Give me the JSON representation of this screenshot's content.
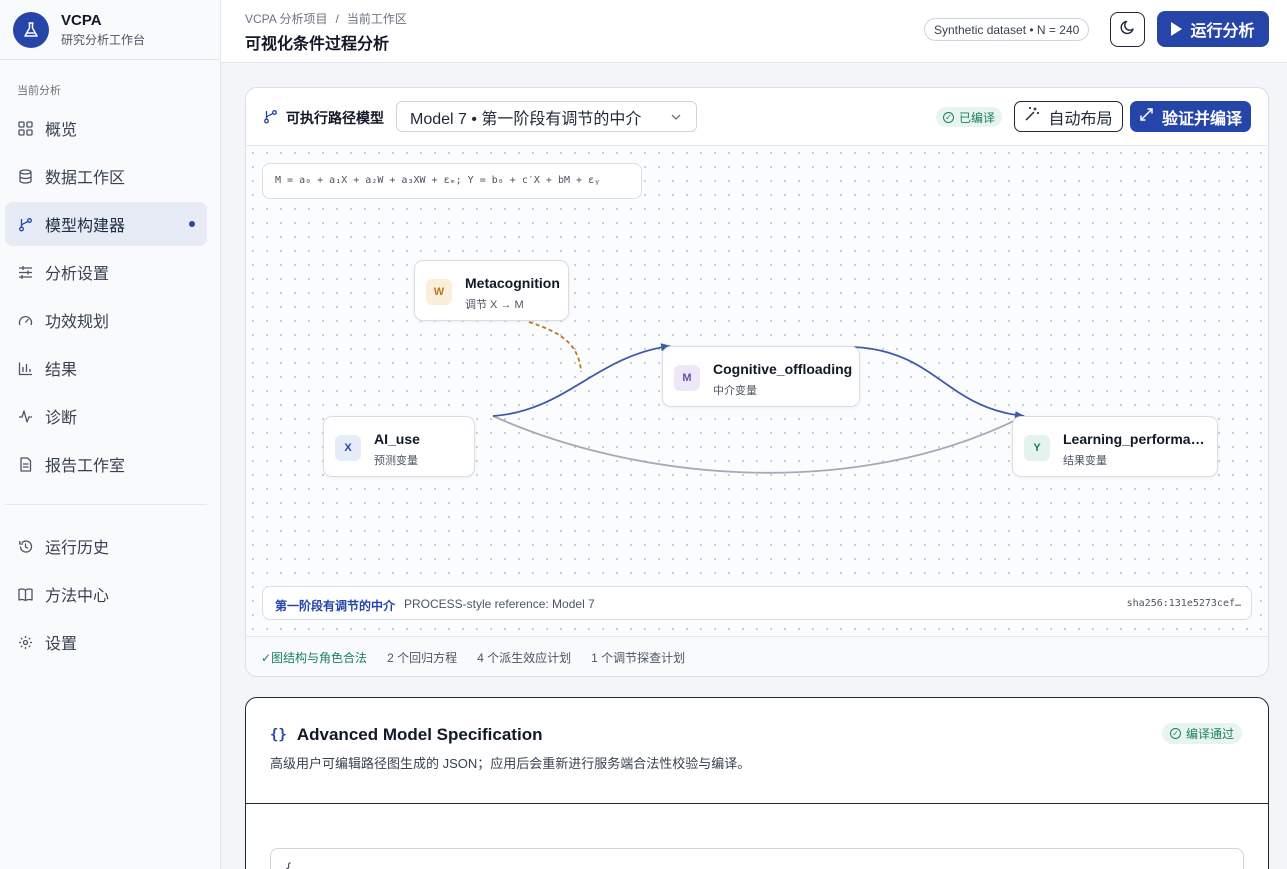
{
  "brand": {
    "title": "VCPA",
    "subtitle": "研究分析工作台"
  },
  "sidebar": {
    "section_label": "当前分析",
    "items": [
      {
        "label": "概览",
        "icon": "grid-icon"
      },
      {
        "label": "数据工作区",
        "icon": "database-icon"
      },
      {
        "label": "模型构建器",
        "icon": "branch-icon",
        "active": true
      },
      {
        "label": "分析设置",
        "icon": "sliders-icon"
      },
      {
        "label": "功效规划",
        "icon": "gauge-icon"
      },
      {
        "label": "结果",
        "icon": "bar-chart-icon"
      },
      {
        "label": "诊断",
        "icon": "pulse-icon"
      },
      {
        "label": "报告工作室",
        "icon": "document-icon"
      }
    ],
    "bottom_items": [
      {
        "label": "运行历史",
        "icon": "history-icon"
      },
      {
        "label": "方法中心",
        "icon": "book-icon"
      },
      {
        "label": "设置",
        "icon": "gear-icon"
      }
    ]
  },
  "header": {
    "breadcrumb": [
      "VCPA 分析项目",
      "当前工作区"
    ],
    "breadcrumb_sep": "/",
    "title": "可视化条件过程分析",
    "dataset_pill": "Synthetic dataset • N = 240",
    "run_label": "运行分析"
  },
  "model_card": {
    "title": "可执行路径模型",
    "selected_model": "Model 7 • 第一阶段有调节的中介",
    "compiled_badge": "已编译",
    "auto_layout_label": "自动布局",
    "validate_label": "验证并编译",
    "equation": "M = a₀ + a₁X + a₂W + a₃XW + εₘ; Y = b₀ + c′X + bM + εᵧ",
    "nodes": {
      "w": {
        "tag": "W",
        "name": "Metacognition",
        "role": "调节 X → M"
      },
      "m": {
        "tag": "M",
        "name": "Cognitive_offloading",
        "role": "中介变量"
      },
      "x": {
        "tag": "X",
        "name": "AI_use",
        "role": "预测变量"
      },
      "y": {
        "tag": "Y",
        "name": "Learning_performa…",
        "role": "结果变量"
      }
    },
    "reference": {
      "title": "第一阶段有调节的中介",
      "text": "PROCESS-style reference: Model 7",
      "hash": "sha256:131e5273cef…"
    },
    "footer": [
      "✓图结构与角色合法",
      "2 个回归方程",
      "4 个派生效应计划",
      "1 个调节探查计划"
    ]
  },
  "spec_card": {
    "icon_text": "{}",
    "title": "Advanced Model Specification",
    "description": "高级用户可编辑路径图生成的 JSON；应用后会重新进行服务端合法性校验与编译。",
    "badge": "编译通过",
    "code_start": "{"
  },
  "colors": {
    "accent": "#2546a8",
    "success": "#1b7f5e",
    "moderation_edge": "#b7791f",
    "direct_edge": "#a3aab8"
  }
}
